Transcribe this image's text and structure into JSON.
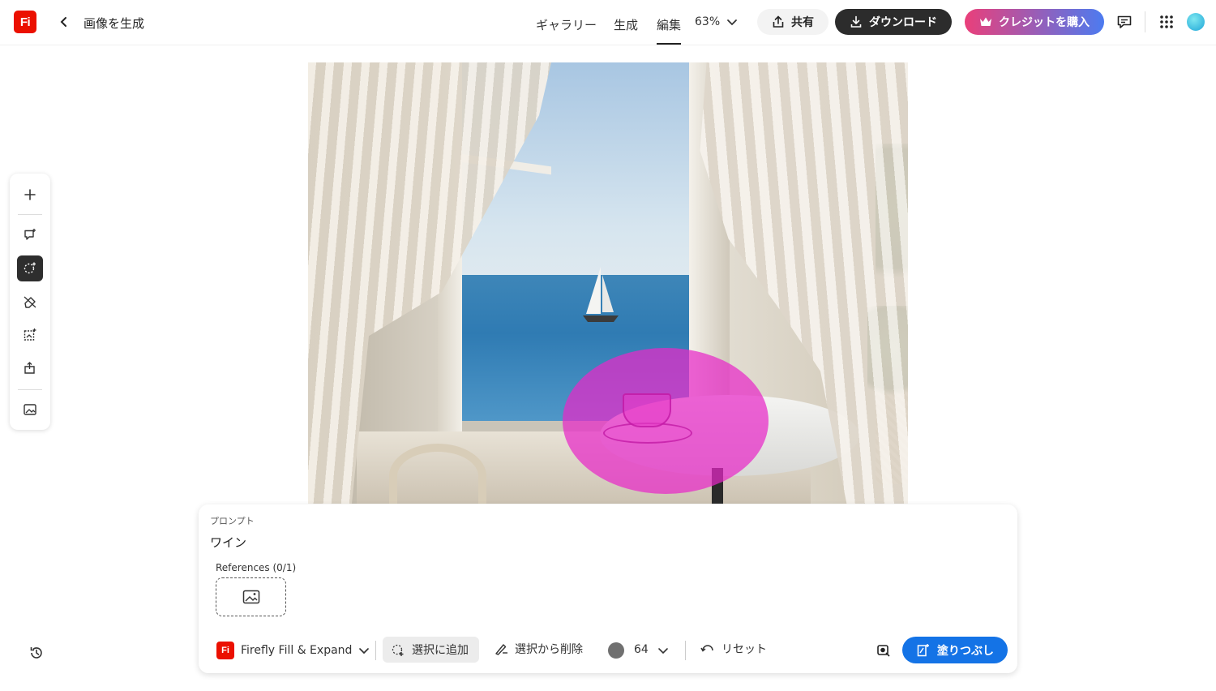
{
  "app": {
    "logo_text": "Fi",
    "page_title": "画像を生成"
  },
  "nav": {
    "gallery": "ギャラリー",
    "generate": "生成",
    "edit": "編集"
  },
  "zoom": {
    "level": "63%"
  },
  "actions": {
    "share": "共有",
    "download": "ダウンロード",
    "buy_credits": "クレジットを購入"
  },
  "colors": {
    "brand": "#eb1000",
    "primary_button": "#1473e6",
    "mask": "#e828c8",
    "download_bg": "#2c2c2c"
  },
  "toolbar": {
    "icons": [
      "add-icon",
      "generative-fill-icon",
      "selection-icon",
      "remove-icon",
      "expand-icon",
      "insert-icon",
      "image-icon"
    ],
    "active_tool": "selection-icon"
  },
  "panel": {
    "prompt_label": "プロンプト",
    "prompt_value": "ワイン",
    "references_label": "References (0/1)",
    "model_name": "Firefly Fill & Expand",
    "add_selection": "選択に追加",
    "remove_selection": "選択から削除",
    "brush_size": "64",
    "reset": "リセット",
    "fill": "塗りつぶし"
  }
}
